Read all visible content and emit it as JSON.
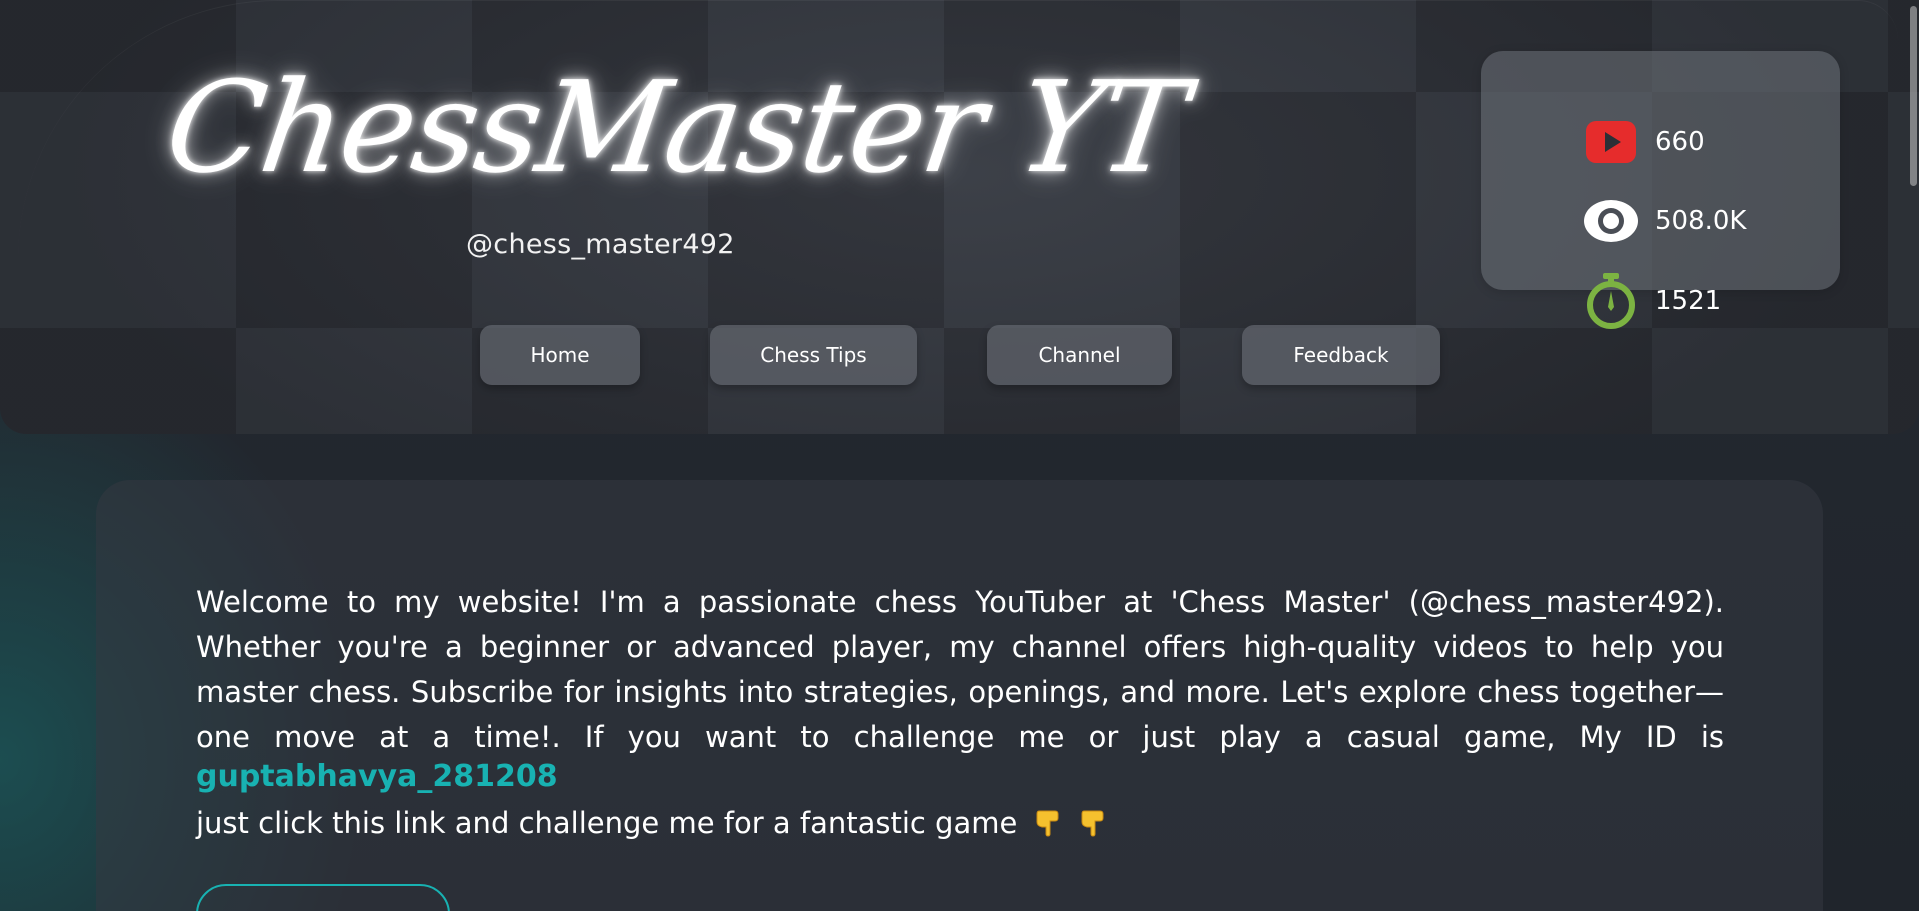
{
  "brand": {
    "title": "ChessMaster YT",
    "handle": "@chess_master492"
  },
  "stats": [
    {
      "icon": "youtube-icon",
      "value": "660",
      "color": "#e62c2c"
    },
    {
      "icon": "eye-icon",
      "value": "508.0K",
      "color": "#ffffff"
    },
    {
      "icon": "stopwatch-icon",
      "value": "1521",
      "color": "#7cb342"
    }
  ],
  "nav": {
    "home": "Home",
    "tips": "Chess Tips",
    "channel": "Channel",
    "feedback": "Feedback"
  },
  "intro": {
    "text": "Welcome to my website! I'm a passionate chess YouTuber at 'Chess Master' (@chess_master492). Whether you're a beginner or advanced player, my channel offers high-quality videos to help you master chess. Subscribe for insights into strategies, openings, and more. Let's explore chess together—one move at a time!. If you want to challenge me or just play a casual game, My ID is",
    "id_link": "guptabhavya_281208",
    "cta": "just click this link and challenge me for a fantastic game"
  },
  "colors": {
    "accent": "#18b2b2",
    "youtube": "#e62c2c",
    "timer": "#7cb342"
  }
}
